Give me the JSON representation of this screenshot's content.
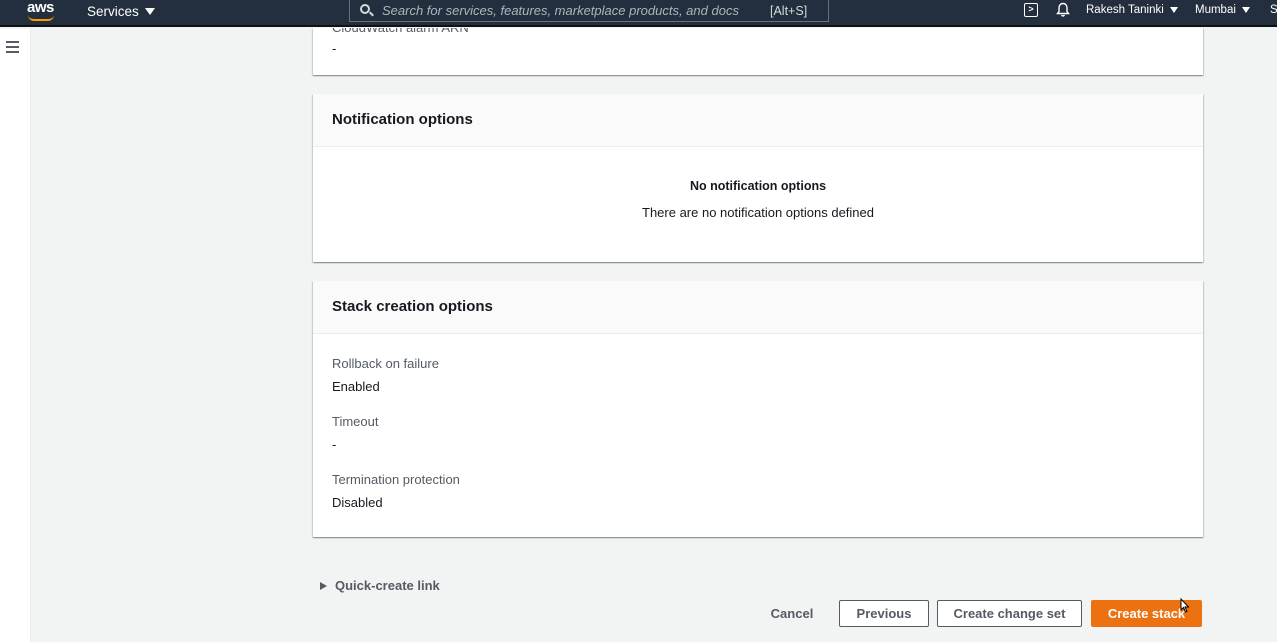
{
  "topnav": {
    "logo_text": "aws",
    "services_label": "Services",
    "search_placeholder": "Search for services, features, marketplace products, and docs",
    "search_shortcut": "[Alt+S]",
    "user_name": "Rakesh Taninki",
    "region": "Mumbai",
    "support_initial": "S"
  },
  "cards": {
    "top": {
      "label_cut": "CloudWatch alarm ARN",
      "value": "-"
    },
    "notification": {
      "title": "Notification options",
      "empty_title": "No notification options",
      "empty_desc": "There are no notification options defined"
    },
    "stack_creation": {
      "title": "Stack creation options",
      "items": [
        {
          "label": "Rollback on failure",
          "value": "Enabled"
        },
        {
          "label": "Timeout",
          "value": "-"
        },
        {
          "label": "Termination protection",
          "value": "Disabled"
        }
      ]
    }
  },
  "footer": {
    "quick_create_link": "Quick-create link",
    "cancel": "Cancel",
    "previous": "Previous",
    "create_change_set": "Create change set",
    "create_stack": "Create stack"
  },
  "colors": {
    "nav_bg": "#232f3e",
    "primary": "#ec7211",
    "aws_smile": "#ff9900"
  },
  "icons": [
    "aws-logo",
    "search-icon",
    "cloudshell-icon",
    "bell-icon",
    "hamburger-icon",
    "caret-right-icon",
    "cursor-icon"
  ]
}
